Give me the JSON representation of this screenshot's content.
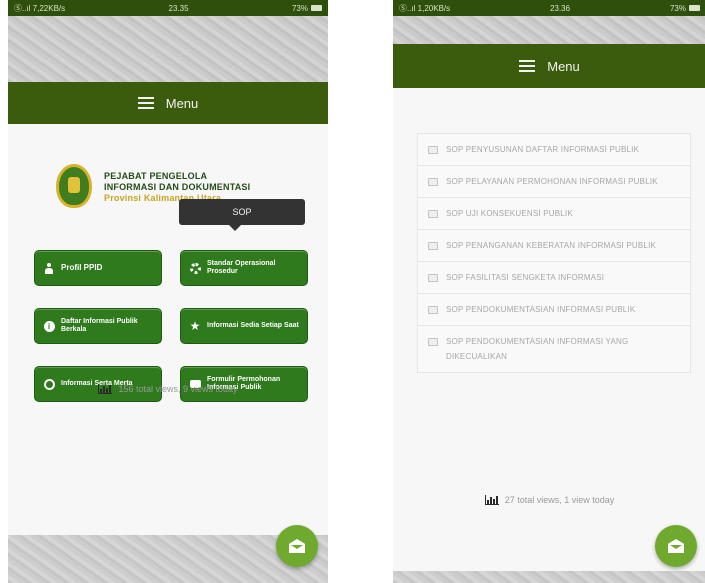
{
  "left_screen": {
    "status_bar": {
      "network": "Ⓢ..ıl 7,22KB/s",
      "time": "23.35",
      "battery": "73%"
    },
    "menu_label": "Menu",
    "logo_text": {
      "line1": "PEJABAT PENGELOLA",
      "line2": "INFORMASI DAN DOKUMENTASI",
      "line3": "Provinsi Kalimantan Utara"
    },
    "tooltip": "SOP",
    "buttons": [
      {
        "label": "Profil PPID",
        "icon": "user-icon"
      },
      {
        "label": "Standar Operasional Prosedur",
        "icon": "gear-icon"
      },
      {
        "label": "Daftar Informasi Publik Berkala",
        "icon": "info-icon"
      },
      {
        "label": "Informasi Sedia Setiap Saat",
        "icon": "star-icon"
      },
      {
        "label": "Informasi Serta Merta",
        "icon": "globe-icon"
      },
      {
        "label": "Formulir Permohonan Informasi Publik",
        "icon": "chat-icon"
      }
    ],
    "views": "156 total views, 9 views today"
  },
  "right_screen": {
    "status_bar": {
      "network": "Ⓢ..ıl 1,20KB/s",
      "time": "23.36",
      "battery": "73%"
    },
    "menu_label": "Menu",
    "sop_items": [
      "SOP PENYUSUNAN DAFTAR INFORMASI PUBLIK",
      "SOP PELAYANAN PERMOHONAN INFORMASI PUBLIK",
      "SOP UJI KONSEKUENSI PUBLIK",
      "SOP PENANGANAN KEBERATAN INFORMASI PUBLIK",
      "SOP FASILITASI SENGKETA INFORMASI",
      "SOP PENDOKUMENTASIAN INFORMASI PUBLIK",
      "SOP PENDOKUMENTASIAN INFORMASI YANG DIKECUALIKAN"
    ],
    "views": "27 total views, 1 view today"
  },
  "colors": {
    "status_bar": "#2f4f0c",
    "menu_bar": "#3b5c0d",
    "button_green": "#2e7a1c",
    "fab_green": "#6faa2f",
    "logo_gold": "#c9a425"
  }
}
